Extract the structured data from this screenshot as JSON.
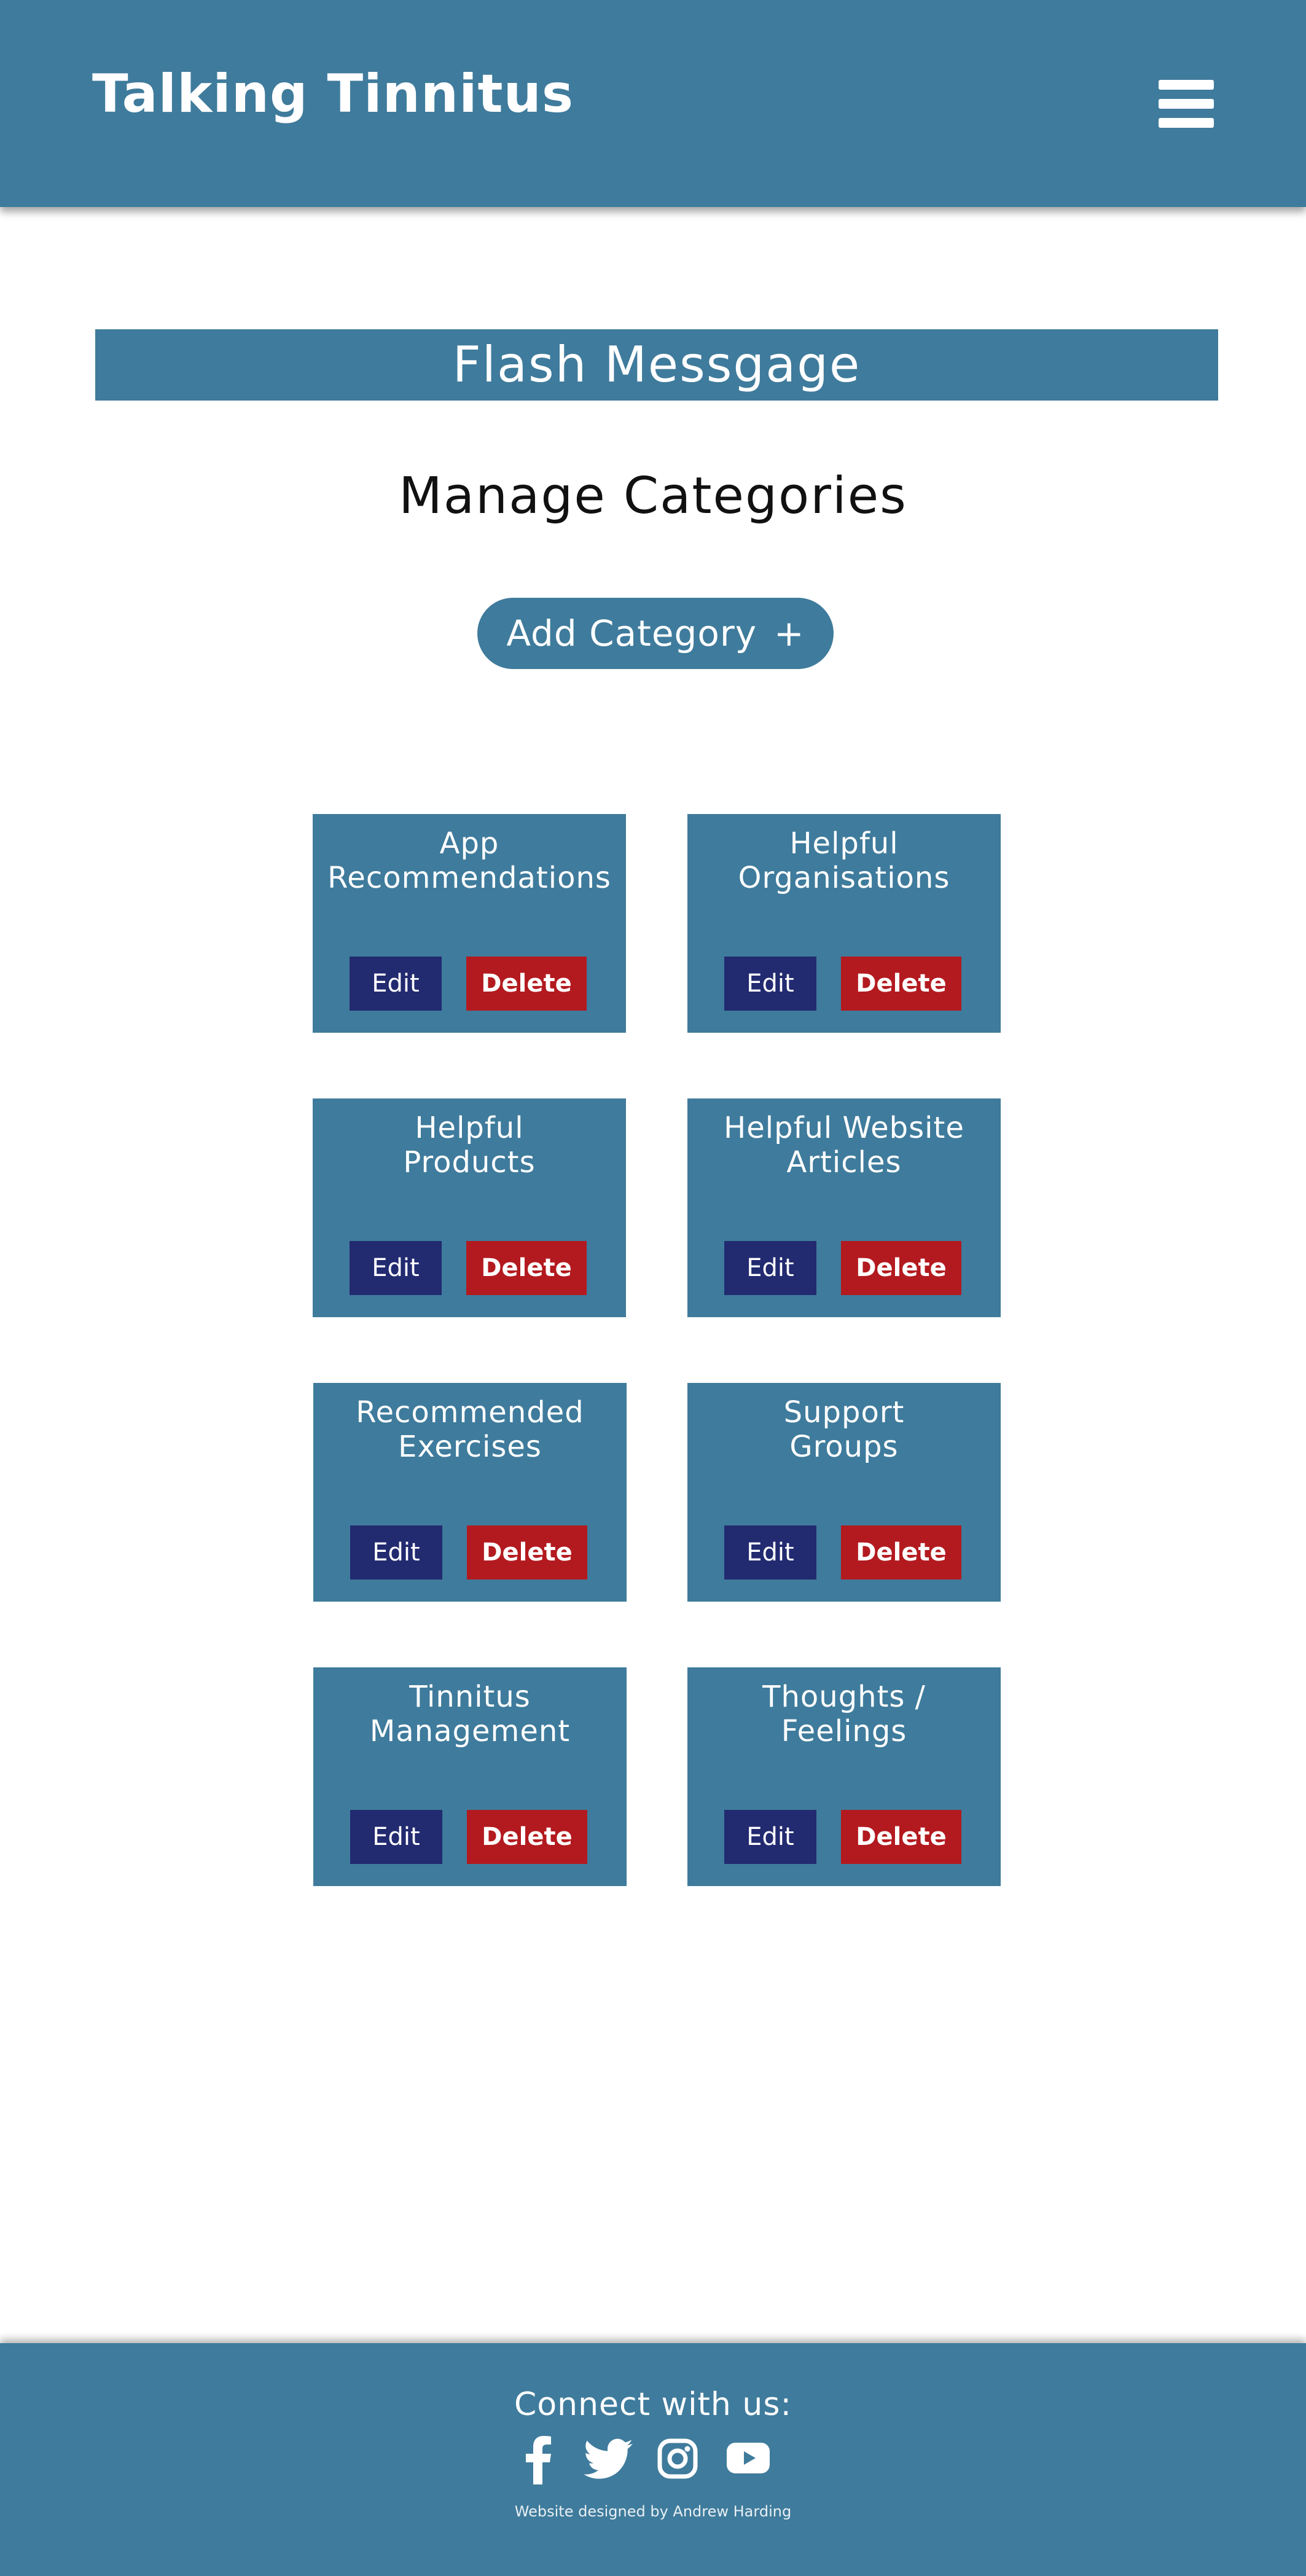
{
  "header": {
    "brand": "Talking Tinnitus",
    "menu_icon": "hamburger-menu-icon"
  },
  "flash": {
    "message": "Flash Messgage"
  },
  "main": {
    "title": "Manage Categories",
    "add_button_label": "Add Category",
    "add_button_icon": "+"
  },
  "categories": [
    {
      "name_line1": "App",
      "name_line2": "Recommendations",
      "edit_label": "Edit",
      "delete_label": "Delete"
    },
    {
      "name_line1": "Helpful",
      "name_line2": "Organisations",
      "edit_label": "Edit",
      "delete_label": "Delete"
    },
    {
      "name_line1": "Helpful",
      "name_line2": "Products",
      "edit_label": "Edit",
      "delete_label": "Delete"
    },
    {
      "name_line1": "Helpful Website",
      "name_line2": "Articles",
      "edit_label": "Edit",
      "delete_label": "Delete"
    },
    {
      "name_line1": "Recommended",
      "name_line2": "Exercises",
      "edit_label": "Edit",
      "delete_label": "Delete"
    },
    {
      "name_line1": "Support",
      "name_line2": "Groups",
      "edit_label": "Edit",
      "delete_label": "Delete"
    },
    {
      "name_line1": "Tinnitus",
      "name_line2": "Management",
      "edit_label": "Edit",
      "delete_label": "Delete"
    },
    {
      "name_line1": "Thoughts /",
      "name_line2": "Feelings",
      "edit_label": "Edit",
      "delete_label": "Delete"
    }
  ],
  "footer": {
    "heading": "Connect with us:",
    "social_icons": [
      "facebook-icon",
      "twitter-icon",
      "instagram-icon",
      "youtube-icon"
    ],
    "credit": "Website designed by Andrew Harding"
  },
  "colors": {
    "primary": "#3f7b9c",
    "edit": "#222a70",
    "delete": "#b31a1f",
    "text_on_primary": "#ffffff"
  }
}
